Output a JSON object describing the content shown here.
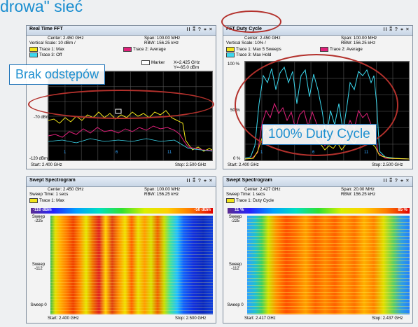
{
  "heading": "drowa\" sieć",
  "colors": {
    "accent": "#1d8fd0",
    "ring": "#b3312c",
    "trace_yellow": "#f2e51a",
    "trace_cyan": "#3cd9ef",
    "trace_magenta": "#e0207a"
  },
  "panels": {
    "fft": {
      "title": "Real Time FFT",
      "ctrls": "II ⁑ ? ⌖ ×",
      "center": "Center: 2.450 GHz",
      "span": "Span: 100.00 MHz",
      "vscale": "Vertical Scale: 10 dBm /",
      "rbw": "RBW: 156.25 kHz",
      "trace1": "Trace 1: Max",
      "trace2": "Trace 2: Average",
      "trace3": "Trace 3: Off",
      "marker_label": "Marker",
      "marker_x": "X=2.425 GHz",
      "marker_y": "Y=-65.0 dBm",
      "y_top": "-70 dBm",
      "y_bottom": "-120 dBm",
      "start": "Start: 2.400 GHz",
      "stop": "Stop: 2.500 GHz",
      "channels": [
        "1",
        "6",
        "11"
      ]
    },
    "duty": {
      "title": "FFT Duty Cycle",
      "ctrls": "II ⁑ ? ⌖ ×",
      "center": "Center: 2.450 GHz",
      "span": "Span: 100.00 MHz",
      "vscale": "Vertical Scale: 10% /",
      "rbw": "RBW: 156.25 kHz",
      "trace1": "Trace 1: Max 5 Sweeps",
      "trace2": "Trace 2: Average",
      "trace3": "Trace 3: Max Hold",
      "y_top": "100 %",
      "y_mid": "50 %",
      "y_bottom": "0 %",
      "start": "Start: 2.400 GHz",
      "stop": "Stop: 2.500 GHz",
      "channels": [
        "1",
        "6",
        "11"
      ]
    },
    "spec1": {
      "title": "Swept Spectrogram",
      "ctrls": "II ⁑ ? ⌖ ×",
      "center": "Center: 2.450 GHz",
      "span": "Span: 100.00 MHz",
      "sweep": "Sweep Time: 1 secs",
      "rbw": "RBW: 156.25 kHz",
      "trace1": "Trace 1: Max",
      "scale_low": "-110 dBm",
      "scale_high": "-50 dBm",
      "sweep_top": "Sweep -225",
      "sweep_mid": "Sweep -112",
      "sweep_bottom": "Sweep 0",
      "start": "Start: 2.400 GHz",
      "stop": "Stop: 2.500 GHz"
    },
    "spec2": {
      "title": "Swept Spectrogram",
      "ctrls": "II ⁑ ? ⌖ ×",
      "center": "Center: 2.427 GHz",
      "span": "Span: 20.00 MHz",
      "sweep": "Sweep Time: 1 secs",
      "rbw": "RBW: 156.25 kHz",
      "trace1": "Trace 1: Duty Cycle",
      "scale_low": "11 %",
      "scale_high": "85 %",
      "sweep_top": "Sweep -225",
      "sweep_mid": "Sweep -112",
      "sweep_bottom": "Sweep 0",
      "start": "Start: 2.417 GHz",
      "stop": "Stop: 2.437 GHz"
    }
  },
  "callouts": {
    "gap": "Brak odstępów",
    "duty": "100% Duty Cycle"
  }
}
